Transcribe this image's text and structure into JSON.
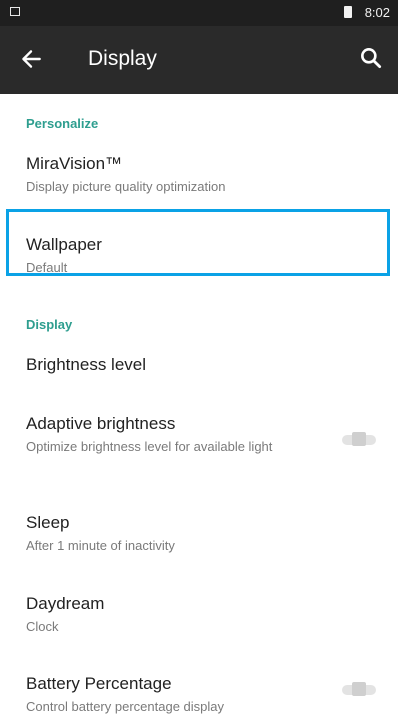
{
  "status_bar": {
    "time": "8:02"
  },
  "toolbar": {
    "title": "Display"
  },
  "sections": {
    "personalize": "Personalize",
    "display": "Display"
  },
  "settings": {
    "miravision": {
      "title": "MiraVision™",
      "subtitle": "Display picture quality optimization"
    },
    "wallpaper": {
      "title": "Wallpaper",
      "subtitle": "Default"
    },
    "brightness": {
      "title": "Brightness level"
    },
    "adaptive": {
      "title": "Adaptive brightness",
      "subtitle": "Optimize brightness level for available light",
      "enabled": false
    },
    "sleep": {
      "title": "Sleep",
      "subtitle": "After 1 minute of inactivity"
    },
    "daydream": {
      "title": "Daydream",
      "subtitle": "Clock"
    },
    "battery": {
      "title": "Battery Percentage",
      "subtitle": "Control battery percentage display",
      "enabled": false
    }
  },
  "colors": {
    "accent": "#2e9e8f",
    "selection": "#0aa2e6",
    "toolbar": "#2a2a2a"
  }
}
